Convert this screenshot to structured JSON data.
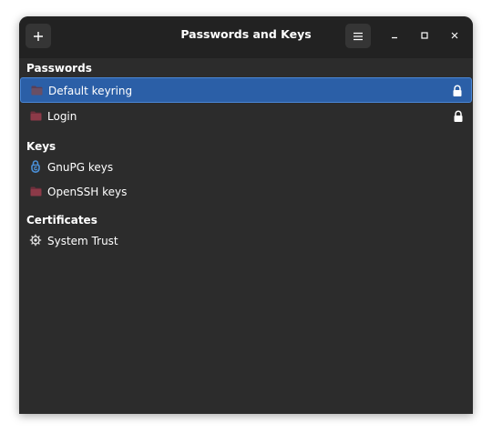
{
  "window": {
    "title": "Passwords and Keys"
  },
  "headerbar": {
    "add_icon": "plus-icon",
    "menu_icon": "hamburger-menu-icon",
    "minimize_icon": "minimize-icon",
    "maximize_icon": "maximize-icon",
    "close_icon": "close-icon"
  },
  "sections": [
    {
      "title": "Passwords",
      "items": [
        {
          "label": "Default keyring",
          "icon": "folder-icon",
          "locked": true,
          "selected": true
        },
        {
          "label": "Login",
          "icon": "folder-icon",
          "locked": true,
          "selected": false
        }
      ]
    },
    {
      "title": "Keys",
      "items": [
        {
          "label": "GnuPG keys",
          "icon": "gnupg-icon",
          "locked": false,
          "selected": false
        },
        {
          "label": "OpenSSH keys",
          "icon": "folder-icon",
          "locked": false,
          "selected": false
        }
      ]
    },
    {
      "title": "Certificates",
      "items": [
        {
          "label": "System Trust",
          "icon": "certificate-gear-icon",
          "locked": false,
          "selected": false
        }
      ]
    }
  ],
  "colors": {
    "window_bg": "#2c2c2c",
    "titlebar_bg": "#222222",
    "selection_bg": "#2b5fa7",
    "folder_color": "#8c3a48",
    "gnupg_color": "#4a90d9"
  }
}
